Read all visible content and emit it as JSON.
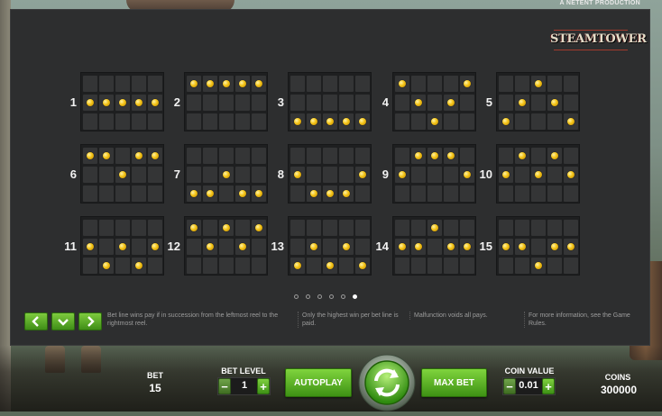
{
  "header": {
    "production_label": "A NETENT PRODUCTION",
    "logo": "STEAMTOWER"
  },
  "paylines": [
    {
      "number": "1",
      "pattern": [
        [
          0,
          0,
          0,
          0,
          0
        ],
        [
          1,
          1,
          1,
          1,
          1
        ],
        [
          0,
          0,
          0,
          0,
          0
        ]
      ]
    },
    {
      "number": "2",
      "pattern": [
        [
          1,
          1,
          1,
          1,
          1
        ],
        [
          0,
          0,
          0,
          0,
          0
        ],
        [
          0,
          0,
          0,
          0,
          0
        ]
      ]
    },
    {
      "number": "3",
      "pattern": [
        [
          0,
          0,
          0,
          0,
          0
        ],
        [
          0,
          0,
          0,
          0,
          0
        ],
        [
          1,
          1,
          1,
          1,
          1
        ]
      ]
    },
    {
      "number": "4",
      "pattern": [
        [
          1,
          0,
          0,
          0,
          1
        ],
        [
          0,
          1,
          0,
          1,
          0
        ],
        [
          0,
          0,
          1,
          0,
          0
        ]
      ]
    },
    {
      "number": "5",
      "pattern": [
        [
          0,
          0,
          1,
          0,
          0
        ],
        [
          0,
          1,
          0,
          1,
          0
        ],
        [
          1,
          0,
          0,
          0,
          1
        ]
      ]
    },
    {
      "number": "6",
      "pattern": [
        [
          1,
          1,
          0,
          1,
          1
        ],
        [
          0,
          0,
          1,
          0,
          0
        ],
        [
          0,
          0,
          0,
          0,
          0
        ]
      ]
    },
    {
      "number": "7",
      "pattern": [
        [
          0,
          0,
          0,
          0,
          0
        ],
        [
          0,
          0,
          1,
          0,
          0
        ],
        [
          1,
          1,
          0,
          1,
          1
        ]
      ]
    },
    {
      "number": "8",
      "pattern": [
        [
          0,
          0,
          0,
          0,
          0
        ],
        [
          1,
          0,
          0,
          0,
          1
        ],
        [
          0,
          1,
          1,
          1,
          0
        ]
      ]
    },
    {
      "number": "9",
      "pattern": [
        [
          0,
          1,
          1,
          1,
          0
        ],
        [
          1,
          0,
          0,
          0,
          1
        ],
        [
          0,
          0,
          0,
          0,
          0
        ]
      ]
    },
    {
      "number": "10",
      "pattern": [
        [
          0,
          1,
          0,
          1,
          0
        ],
        [
          1,
          0,
          1,
          0,
          1
        ],
        [
          0,
          0,
          0,
          0,
          0
        ]
      ]
    },
    {
      "number": "11",
      "pattern": [
        [
          0,
          0,
          0,
          0,
          0
        ],
        [
          1,
          0,
          1,
          0,
          1
        ],
        [
          0,
          1,
          0,
          1,
          0
        ]
      ]
    },
    {
      "number": "12",
      "pattern": [
        [
          1,
          0,
          1,
          0,
          1
        ],
        [
          0,
          1,
          0,
          1,
          0
        ],
        [
          0,
          0,
          0,
          0,
          0
        ]
      ]
    },
    {
      "number": "13",
      "pattern": [
        [
          0,
          0,
          0,
          0,
          0
        ],
        [
          0,
          1,
          0,
          1,
          0
        ],
        [
          1,
          0,
          1,
          0,
          1
        ]
      ]
    },
    {
      "number": "14",
      "pattern": [
        [
          0,
          0,
          1,
          0,
          0
        ],
        [
          1,
          1,
          0,
          1,
          1
        ],
        [
          0,
          0,
          0,
          0,
          0
        ]
      ]
    },
    {
      "number": "15",
      "pattern": [
        [
          0,
          0,
          0,
          0,
          0
        ],
        [
          1,
          1,
          0,
          1,
          1
        ],
        [
          0,
          0,
          1,
          0,
          0
        ]
      ]
    }
  ],
  "pagination": {
    "total": 6,
    "active_index": 5
  },
  "nav": {
    "prev_icon": "chevron-left-icon",
    "down_icon": "chevron-down-icon",
    "next_icon": "chevron-right-icon"
  },
  "info": {
    "text1": "Bet line wins pay if in succession from the leftmost reel to the rightmost reel.",
    "text2": "Only the highest win per bet line is paid.",
    "text3": "Malfunction voids all pays.",
    "text4": "For more information, see the Game Rules."
  },
  "controls": {
    "bet_label": "BET",
    "bet_value": "15",
    "bet_level_label": "BET LEVEL",
    "bet_level_value": "1",
    "minus_label": "−",
    "plus_label": "+",
    "autoplay_label": "AUTOPLAY",
    "spin_icon": "spin-arrows-icon",
    "max_bet_label": "MAX BET",
    "coin_value_label": "COIN VALUE",
    "coin_value": "0.01",
    "coins_label": "COINS",
    "coins_value": "300000"
  },
  "colors": {
    "panel_bg": "#2d2e2f",
    "cell_bg": "#343536",
    "coin_gold": "#f4c416",
    "button_green": "#3e9214"
  }
}
